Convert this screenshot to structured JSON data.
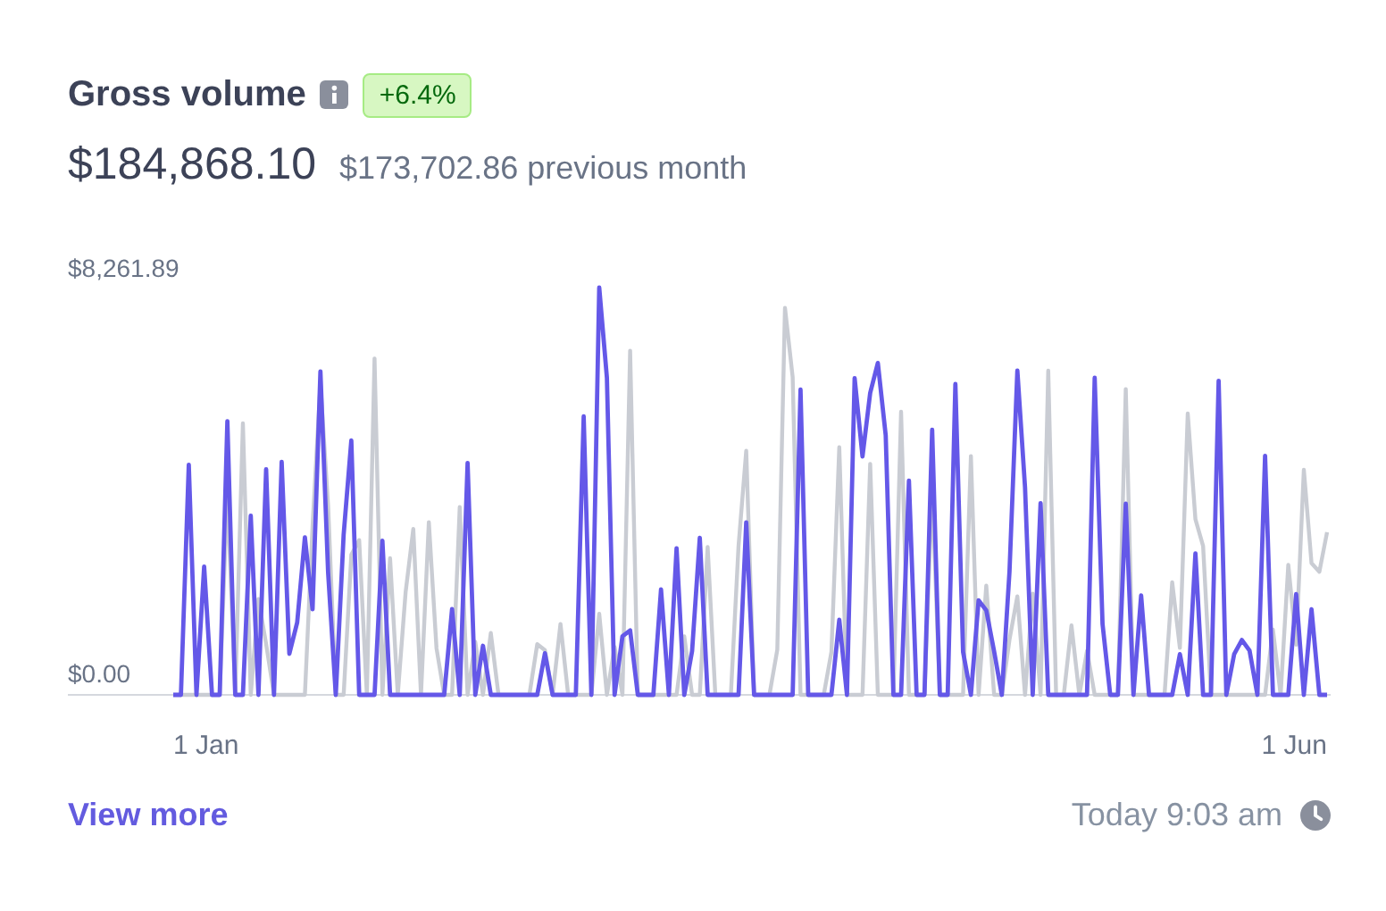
{
  "card": {
    "title": "Gross volume",
    "change_badge": "+6.4%",
    "amount": "$184,868.10",
    "previous": "$173,702.86 previous month"
  },
  "chart": {
    "y_max_label": "$8,261.89",
    "y_min_label": "$0.00",
    "x_start_label": "1 Jan",
    "x_end_label": "1 Jun"
  },
  "footer": {
    "link": "View more",
    "updated": "Today 9:03 am"
  }
}
